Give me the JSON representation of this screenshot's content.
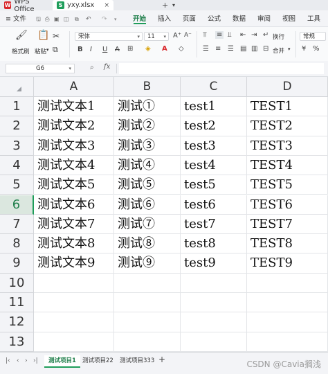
{
  "titlebar": {
    "app_tab": "WPS Office",
    "file_tab": "yxy.xlsx",
    "close_glyph": "×",
    "new_tab_glyph": "+",
    "dropdown_glyph": "▾"
  },
  "menu": {
    "file": "≡ 文件",
    "items": [
      "开始",
      "插入",
      "页面",
      "公式",
      "数据",
      "审阅",
      "视图",
      "工具"
    ],
    "active": "开始"
  },
  "ribbon": {
    "format_painter": "格式刷",
    "paste": "粘贴",
    "font_name": "宋体",
    "font_size": "11",
    "wrap_text": "换行",
    "merge": "合并",
    "number_format": "常规",
    "bold": "B",
    "italic": "I",
    "underline": "U",
    "strike": "A"
  },
  "formula_bar": {
    "cell_ref": "G6",
    "fx": "fx",
    "value": ""
  },
  "columns": [
    "A",
    "B",
    "C",
    "D"
  ],
  "rows": [
    {
      "num": "1",
      "cells": [
        "测试文本1",
        "测试①",
        "test1",
        "TEST1"
      ]
    },
    {
      "num": "2",
      "cells": [
        "测试文本2",
        "测试②",
        "test2",
        "TEST2"
      ]
    },
    {
      "num": "3",
      "cells": [
        "测试文本3",
        "测试③",
        "test3",
        "TEST3"
      ]
    },
    {
      "num": "4",
      "cells": [
        "测试文本4",
        "测试④",
        "test4",
        "TEST4"
      ]
    },
    {
      "num": "5",
      "cells": [
        "测试文本5",
        "测试⑤",
        "test5",
        "TEST5"
      ]
    },
    {
      "num": "6",
      "cells": [
        "测试文本6",
        "测试⑥",
        "test6",
        "TEST6"
      ]
    },
    {
      "num": "7",
      "cells": [
        "测试文本7",
        "测试⑦",
        "test7",
        "TEST7"
      ]
    },
    {
      "num": "8",
      "cells": [
        "测试文本8",
        "测试⑧",
        "test8",
        "TEST8"
      ]
    },
    {
      "num": "9",
      "cells": [
        "测试文本9",
        "测试⑨",
        "test9",
        "TEST9"
      ]
    },
    {
      "num": "10",
      "cells": [
        "",
        "",
        "",
        ""
      ]
    },
    {
      "num": "11",
      "cells": [
        "",
        "",
        "",
        ""
      ]
    },
    {
      "num": "12",
      "cells": [
        "",
        "",
        "",
        ""
      ]
    },
    {
      "num": "13",
      "cells": [
        "",
        "",
        "",
        ""
      ]
    }
  ],
  "active_row": "6",
  "sheets": [
    "测试项目1",
    "测试项目22",
    "测试项目333"
  ],
  "active_sheet": "测试项目1",
  "add_sheet_glyph": "+",
  "watermark": "CSDN @Cavia搁浅",
  "colors": {
    "accent": "#1e9d5a",
    "wps_red": "#d8262b"
  }
}
